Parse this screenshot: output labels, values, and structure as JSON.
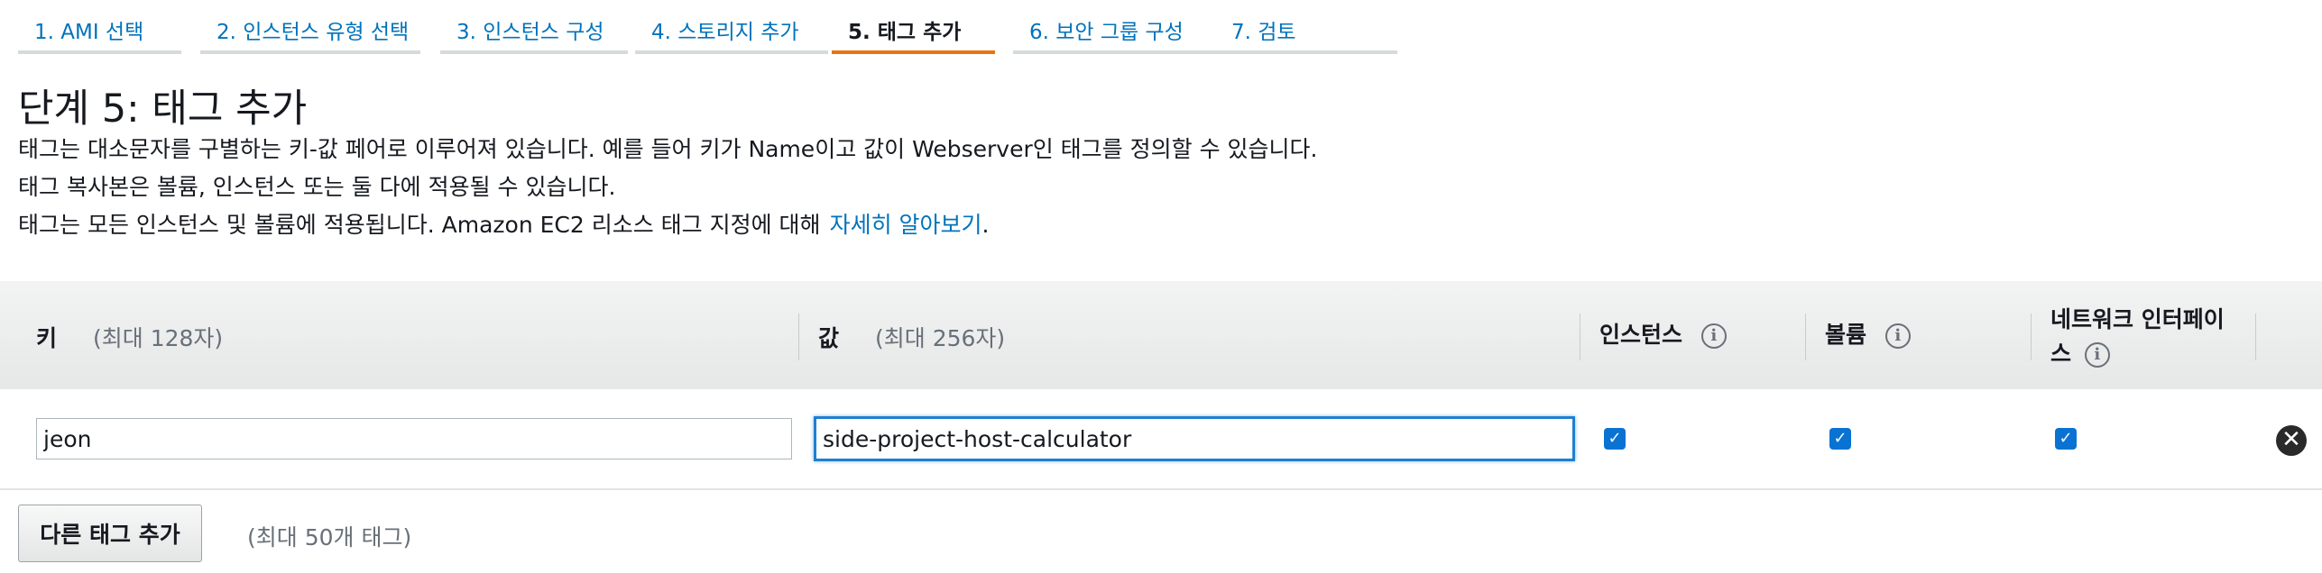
{
  "wizard": {
    "steps": [
      {
        "label": "1. AMI 선택"
      },
      {
        "label": "2. 인스턴스 유형 선택"
      },
      {
        "label": "3. 인스턴스 구성"
      },
      {
        "label": "4. 스토리지 추가"
      },
      {
        "label": "5. 태그 추가",
        "active": true
      },
      {
        "label": "6. 보안 그룹 구성"
      },
      {
        "label": "7. 검토"
      }
    ]
  },
  "page": {
    "title": "단계 5: 태그 추가",
    "desc_line1": "태그는 대소문자를 구별하는 키-값 페어로 이루어져 있습니다. 예를 들어 키가 Name이고 값이 Webserver인 태그를 정의할 수 있습니다.",
    "desc_line2": "태그 복사본은 볼륨, 인스턴스 또는 둘 다에 적용될 수 있습니다.",
    "desc_line3": "태그는 모든 인스턴스 및 볼륨에 적용됩니다. Amazon EC2 리소스 태그 지정에 대해",
    "learn_more": "자세히 알아보기",
    "learn_more_suffix": "."
  },
  "table": {
    "columns": {
      "key": {
        "label": "키",
        "hint": "(최대 128자)"
      },
      "value": {
        "label": "값",
        "hint": "(최대 256자)"
      },
      "instances": {
        "label": "인스턴스",
        "icon": "info-icon"
      },
      "volumes": {
        "label": "볼륨",
        "icon": "info-icon"
      },
      "network_interfaces": {
        "label_line1": "네트워크 인터페이",
        "label_line2": "스",
        "icon": "info-icon"
      }
    },
    "rows": [
      {
        "key": "jeon",
        "value": "side-project-host-calculator",
        "instances": true,
        "volumes": true,
        "network_interfaces": true,
        "remove_icon": "close-circle-icon"
      }
    ]
  },
  "footer": {
    "add_button": "다른 태그 추가",
    "max_note": "(최대 50개 태그)"
  },
  "colors": {
    "link": "#0073bb",
    "active_tab": "#ec7211",
    "checkbox": "#0972d3",
    "focus": "#1f7fd1"
  }
}
